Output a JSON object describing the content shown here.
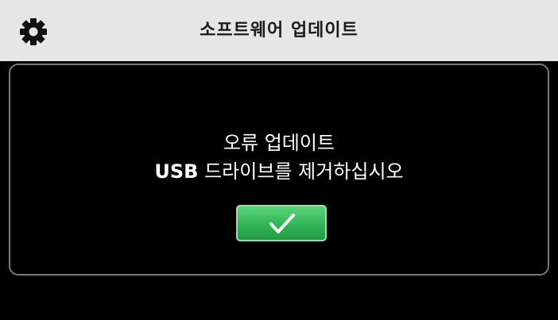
{
  "header": {
    "title": "소프트웨어 업데이트",
    "icon": "gear-icon"
  },
  "dialog": {
    "line1": "오류 업데이트",
    "line2_bold": "USB",
    "line2_rest": " 드라이브를 제거하십시오",
    "confirm_icon": "checkmark-icon"
  },
  "colors": {
    "header_bg": "#e6e6e6",
    "screen_bg": "#000000",
    "button_green": "#33b556",
    "dialog_border": "#7a7a7a"
  }
}
